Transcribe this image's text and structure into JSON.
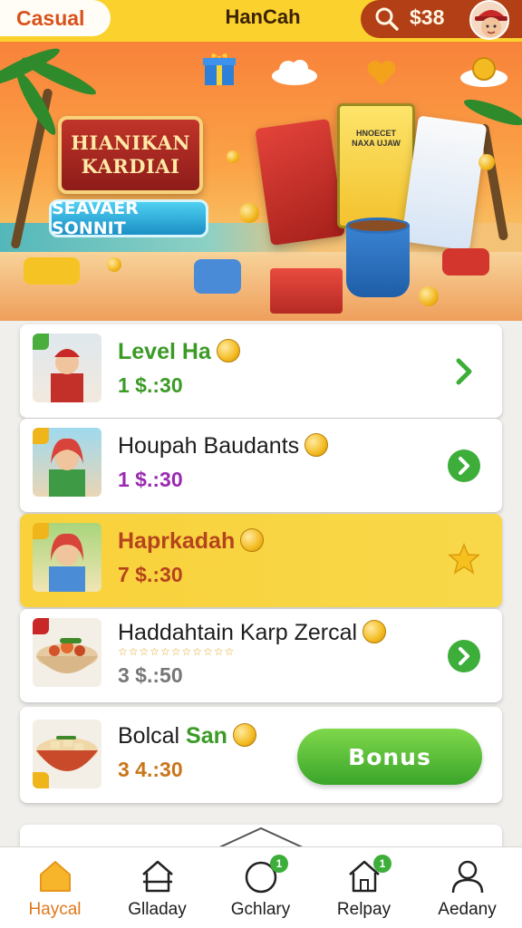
{
  "header": {
    "category_label": "Casual",
    "app_title": "HanCah",
    "balance": "$38"
  },
  "banner": {
    "sign_line1": "HIANIKAN",
    "sign_line2": "KARDIAI",
    "ribbon_text": "SEAVAER SONNIT",
    "bag_text": "HNOECET NAXA UJAW"
  },
  "list": [
    {
      "title": "Level Ha",
      "price": "1 $.:30",
      "price_color": "#3c9a26",
      "title_color": "#3c9a26",
      "action": "chevron"
    },
    {
      "title": "Houpah Baudants",
      "price": "1 $.:30",
      "price_color": "#9a2bb0",
      "title_color": "#1d1d1d",
      "action": "chevron-circle"
    },
    {
      "title": "Haprkadah",
      "price": "7 $.:30",
      "price_color": "#b5441c",
      "title_color": "#b5441c",
      "action": "star"
    },
    {
      "title": "Haddahtain Karp Zercal",
      "stars": "☆☆☆☆☆☆☆☆☆☆☆",
      "price": "3 $.:50",
      "price_color": "#777777",
      "title_color": "#1d1d1d",
      "action": "chevron-circle"
    },
    {
      "title_prefix": "Bolcal",
      "title_suffix": "San",
      "price": "3 4.:30",
      "price_color": "#c9761a",
      "title_color": "#1d1d1d",
      "action": "bonus",
      "button_label": "Bonus"
    }
  ],
  "bottom_nav": [
    {
      "label": "Haycal",
      "icon": "home-icon",
      "active": true
    },
    {
      "label": "Glladay",
      "icon": "house-outline-icon",
      "active": false
    },
    {
      "label": "Gchlary",
      "icon": "circle-icon",
      "active": false,
      "badge": "1"
    },
    {
      "label": "Relpay",
      "icon": "house-badge-icon",
      "active": false,
      "badge": "1"
    },
    {
      "label": "Aedany",
      "icon": "user-icon",
      "active": false
    }
  ],
  "colors": {
    "accent_yellow": "#fbd12e",
    "brand_orange": "#d8521c",
    "balance_pill": "#b23f15",
    "green": "#3eae3a",
    "active_nav": "#e2781c"
  }
}
